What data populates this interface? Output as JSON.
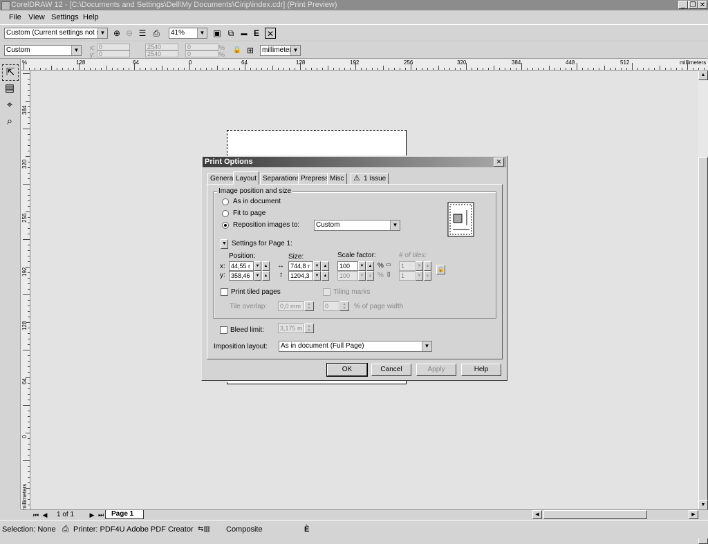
{
  "window": {
    "title": "CorelDRAW 12 - [C:\\Documents and Settings\\Dell\\My Documents\\Cirip\\index.cdr] (Print Preview)",
    "min": "_",
    "restore": "❐",
    "close": "✕"
  },
  "menu": [
    "File",
    "View",
    "Settings",
    "Help"
  ],
  "toolbar1": {
    "preset": "Custom (Current settings not s...",
    "zoom": "41%"
  },
  "toolbar2": {
    "page_preset": "Custom",
    "x_label": "x:",
    "y_label": "y:",
    "x_value": "0",
    "y_value": "0",
    "w_value": "2540",
    "h_value": "2540",
    "sx_value": "0",
    "sy_value": "0",
    "pct1": "%",
    "pct2": "%",
    "units": "millimeters"
  },
  "ruler": {
    "corner": "%",
    "h_labels": [
      "128",
      "64",
      "0",
      "64",
      "128",
      "192",
      "256",
      "320",
      "384",
      "448",
      "512"
    ],
    "h_units": "millimeters",
    "v_labels": [
      "384",
      "320",
      "256",
      "192",
      "128",
      "64",
      "0"
    ],
    "v_units": "millimeters"
  },
  "nav": {
    "page_count": "1 of 1",
    "page_tab": "Page 1"
  },
  "status": {
    "selection": "Selection: None",
    "printer": "Printer: PDF4U Adobe PDF Creator",
    "mode": "Composite",
    "e_glyph": "È"
  },
  "dialog": {
    "title": "Print Options",
    "close": "✕",
    "tabs": [
      "General",
      "Layout",
      "Separations",
      "Prepress",
      "Misc",
      "1 Issue"
    ],
    "group_title": "Image position and size",
    "radio_as_doc": "As in document",
    "radio_fit": "Fit to page",
    "radio_reposition": "Reposition images to:",
    "reposition_value": "Custom",
    "settings_for": "Settings for Page 1:",
    "position_label": "Position:",
    "size_label": "Size:",
    "scale_label": "Scale factor:",
    "tiles_label": "# of tiles:",
    "x_label": "x:",
    "y_label": "y:",
    "pos_x": "44,55 r",
    "pos_y": "358,46",
    "size_w": "744,8 r",
    "size_h": "1204,3",
    "scale_1": "100",
    "scale_2": "100",
    "pct_1": "%",
    "pct_2": "%",
    "tiles_1": "1",
    "tiles_2": "1",
    "print_tiled": "Print tiled pages",
    "tiling_marks": "Tiling marks",
    "tile_overlap": "Tile overlap:",
    "tile_overlap_value": "0,0 mm",
    "tile_pct_value": "0",
    "pct_page_width": "% of page width",
    "bleed_limit": "Bleed limit:",
    "bleed_value": "3,175 m",
    "imposition_label": "Imposition layout:",
    "imposition_value": "As in document (Full Page)",
    "ok": "OK",
    "cancel": "Cancel",
    "apply": "Apply",
    "help": "Help"
  }
}
